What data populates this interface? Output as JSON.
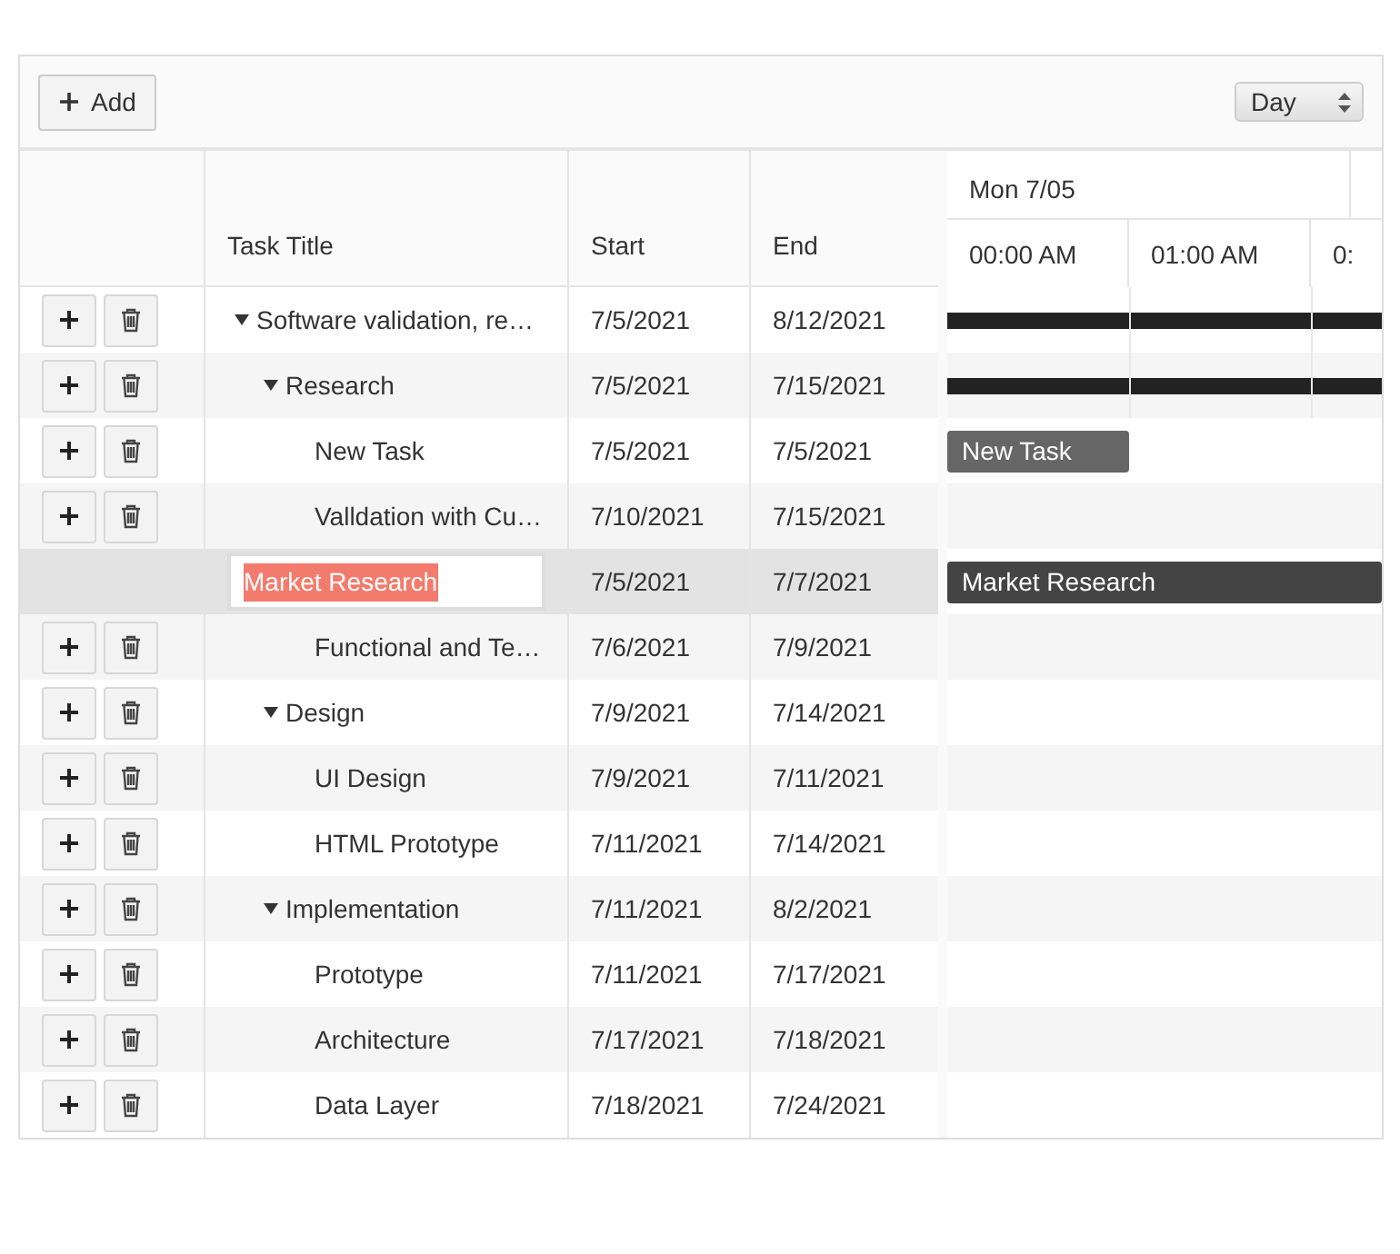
{
  "toolbar": {
    "add_button": "Add",
    "view_select": "Day"
  },
  "columns": [
    "Task Title",
    "Start",
    "End"
  ],
  "timeline": {
    "day": "Mon 7/05",
    "slots": [
      "00:00 AM",
      "01:00 AM",
      "0:"
    ]
  },
  "tasks": [
    {
      "title": "Software validation, re…",
      "start": "7/5/2021",
      "end": "8/12/2021",
      "expanded": true,
      "selected": false,
      "editing": false,
      "bar": {
        "kind": "summary",
        "runs_past_edge": true
      },
      "children": [
        {
          "title": "Research",
          "start": "7/5/2021",
          "end": "7/15/2021",
          "expanded": true,
          "selected": false,
          "editing": false,
          "bar": {
            "kind": "summary",
            "runs_past_edge": true
          },
          "children": [
            {
              "title": "New Task",
              "start": "7/5/2021",
              "end": "7/5/2021",
              "selected": false,
              "editing": false,
              "bar": {
                "kind": "task",
                "runs_past_edge": false,
                "label": "New Task"
              }
            },
            {
              "title": "Valldation with Cu…",
              "start": "7/10/2021",
              "end": "7/15/2021",
              "selected": false,
              "editing": false
            },
            {
              "title": "Market Research",
              "start": "7/5/2021",
              "end": "7/7/2021",
              "selected": true,
              "editing": true,
              "bar": {
                "kind": "task",
                "runs_past_edge": true,
                "label": "Market Research"
              }
            },
            {
              "title": "Functional and Te…",
              "start": "7/6/2021",
              "end": "7/9/2021",
              "selected": false,
              "editing": false
            }
          ]
        },
        {
          "title": "Design",
          "start": "7/9/2021",
          "end": "7/14/2021",
          "expanded": true,
          "selected": false,
          "editing": false,
          "children": [
            {
              "title": "UI Design",
              "start": "7/9/2021",
              "end": "7/11/2021",
              "selected": false,
              "editing": false
            },
            {
              "title": "HTML Prototype",
              "start": "7/11/2021",
              "end": "7/14/2021",
              "selected": false,
              "editing": false
            }
          ]
        },
        {
          "title": "Implementation",
          "start": "7/11/2021",
          "end": "8/2/2021",
          "expanded": true,
          "selected": false,
          "editing": false,
          "children": [
            {
              "title": "Prototype",
              "start": "7/11/2021",
              "end": "7/17/2021",
              "selected": false,
              "editing": false
            },
            {
              "title": "Architecture",
              "start": "7/17/2021",
              "end": "7/18/2021",
              "selected": false,
              "editing": false
            },
            {
              "title": "Data Layer",
              "start": "7/18/2021",
              "end": "7/24/2021",
              "selected": false,
              "editing": false
            }
          ]
        }
      ]
    }
  ]
}
